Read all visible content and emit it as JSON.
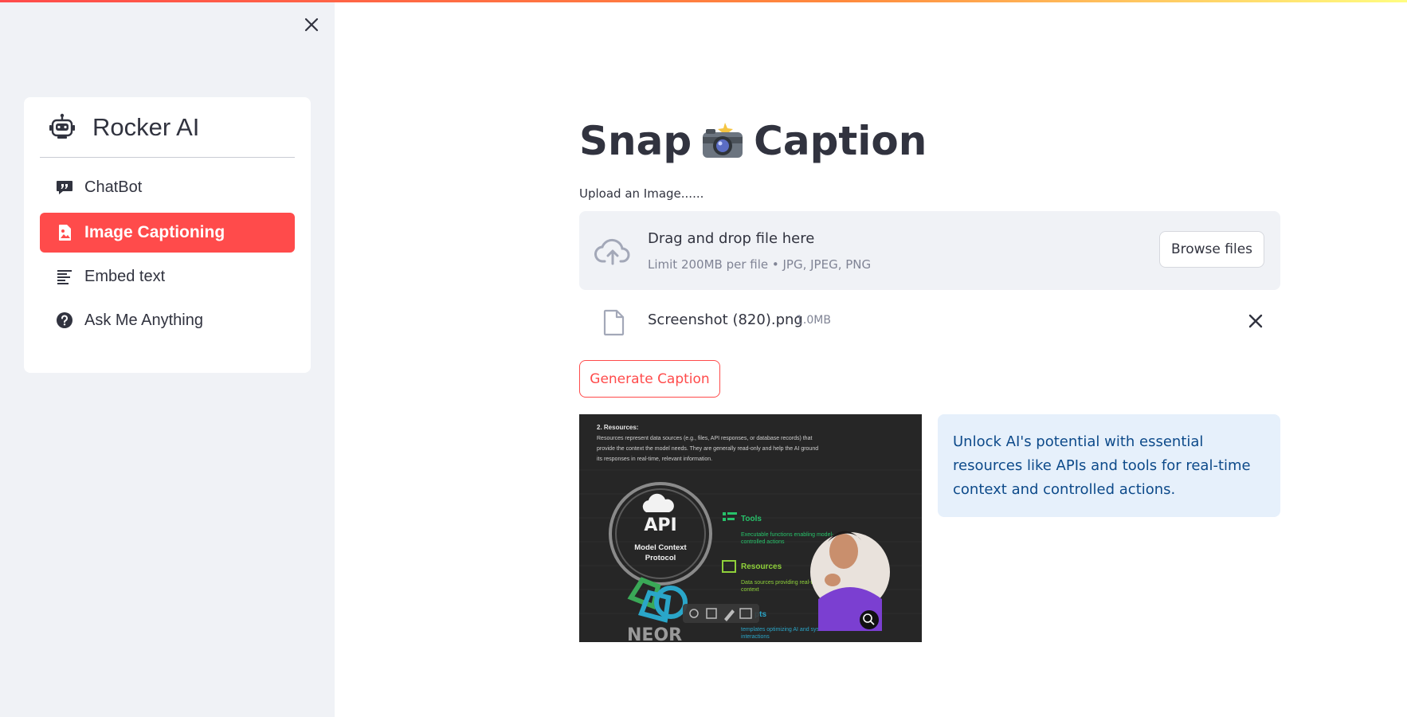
{
  "sidebar": {
    "app_title": "Rocker AI",
    "items": [
      {
        "label": "ChatBot",
        "icon": "chat-quote-icon",
        "active": false
      },
      {
        "label": "Image Captioning",
        "icon": "file-image-icon",
        "active": true
      },
      {
        "label": "Embed text",
        "icon": "text-paragraph-icon",
        "active": false
      },
      {
        "label": "Ask Me Anything",
        "icon": "question-circle-icon",
        "active": false
      }
    ]
  },
  "main": {
    "title_left": "Snap",
    "title_right": "Caption",
    "title_icon": "camera-flash-icon",
    "upload_label": "Upload an Image......",
    "dropzone": {
      "title": "Drag and drop file here",
      "limit": "Limit 200MB per file • JPG, JPEG, PNG",
      "browse_label": "Browse files"
    },
    "file": {
      "name": "Screenshot (820).png",
      "size": "1.0MB"
    },
    "generate_label": "Generate Caption",
    "preview": {
      "heading": "2. Resources:",
      "body_lines": [
        "Resources represent data sources (e.g., files, API responses, or database records) that",
        "provide the context the model needs. They are generally read-only and help the AI ground",
        "its responses in real-time, relevant information."
      ],
      "api_label": "API",
      "protocol_line1": "Model Context",
      "protocol_line2": "Protocol",
      "items": [
        {
          "title": "Tools",
          "desc1": "Executable functions enabling model-",
          "desc2": "controlled actions"
        },
        {
          "title": "Resources",
          "desc1": "Data sources providing real-time, relevant",
          "desc2": "context"
        },
        {
          "title": "pts",
          "desc1": "templates optimizing AI and system",
          "desc2": "interactions"
        }
      ]
    },
    "caption": "Unlock AI's potential with essential resources like APIs and tools for real-time context and controlled actions."
  },
  "colors": {
    "accent": "#ff4b4b",
    "sidebar_bg": "#f0f2f6",
    "caption_bg": "#e6f0fb",
    "caption_text": "#0d4a8a"
  }
}
